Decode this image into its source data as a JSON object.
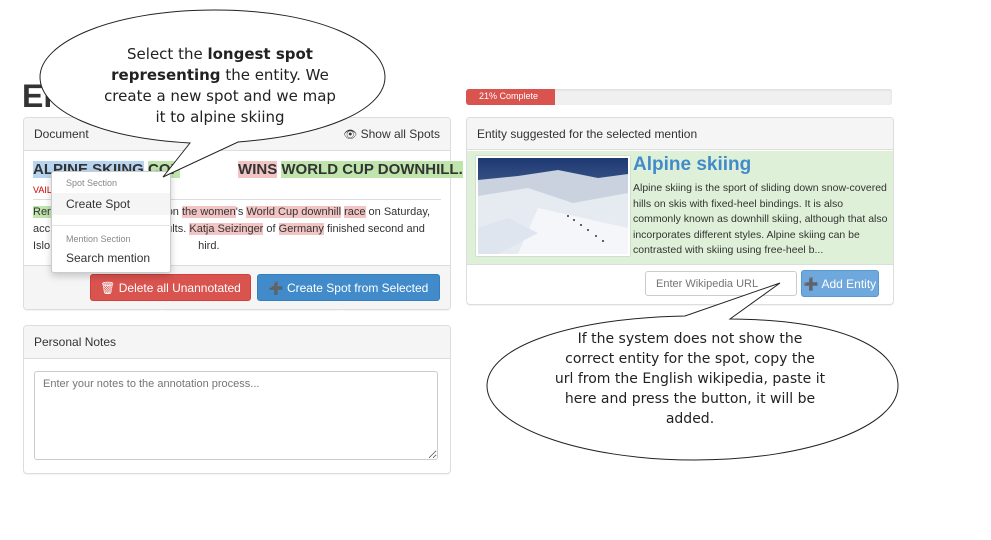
{
  "page": {
    "heading_partial": "Er"
  },
  "document_panel": {
    "title": "Document",
    "show_all_spots": "Show all Spots",
    "headline": {
      "spot1": "ALPINE SKIING",
      "mid": "COF",
      "gap": " ",
      "hidden": "ALPINE SKIING",
      "spot_wins": "WINS",
      "spot_world": "WORLD CUP DOWNHILL."
    },
    "subline": "VAIL",
    "body": {
      "line1": {
        "w1": "Ren",
        "t1": "von ",
        "h1": "the women",
        "t2": "'s ",
        "h2": "World Cup downhill",
        "t3": " ",
        "h3": "race",
        "t4": " on Saturday,"
      },
      "line2": {
        "w1": "acc",
        "t1": "ults. ",
        "h1": "Katja Seizinger",
        "t2": " of ",
        "h2": "Germany",
        "t3": " finished second and"
      },
      "line3": {
        "w1": "Islo",
        "t1": "hird."
      }
    },
    "context_menu": {
      "spot_section": "Spot Section",
      "create_spot": "Create Spot",
      "mention_section": "Mention Section",
      "search_mention": "Search mention"
    },
    "delete_button": "Delete all Unannotated Spot",
    "create_button": "Create Spot from Selected Text"
  },
  "notes_panel": {
    "title": "Personal Notes",
    "placeholder": "Enter your notes to the annotation process..."
  },
  "progress": {
    "label": "21% Complete",
    "value": 0.21
  },
  "entity_panel": {
    "title": "Entity suggested for the selected mention",
    "entity_name": "Alpine skiing",
    "description": "Alpine skiing is the sport of sliding down snow-covered hills on skis with fixed-heel bindings. It is also commonly known as downhill skiing, although that also incorporates different styles. Alpine skiing can be contrasted with skiing using free-heel b...",
    "url_placeholder": "Enter Wikipedia URL",
    "add_button": "Add Entity"
  },
  "callout_top": {
    "line1": "Select the ",
    "bold1": "longest spot",
    "bold2": "representing",
    "line2": " the entity. We",
    "line3": "create a new spot and we map",
    "line4": "it to alpine skiing"
  },
  "callout_bottom": {
    "line1": "If the system does not show the",
    "line2": "correct entity for the spot, copy the",
    "line3": "url from the English wikipedia, paste it",
    "line4": "here and press the button, it will be",
    "line5": "added."
  },
  "colors": {
    "primary": "#428bca",
    "danger": "#d9534f",
    "success_bg": "#dff0d8",
    "entity_title": "#428bca"
  }
}
